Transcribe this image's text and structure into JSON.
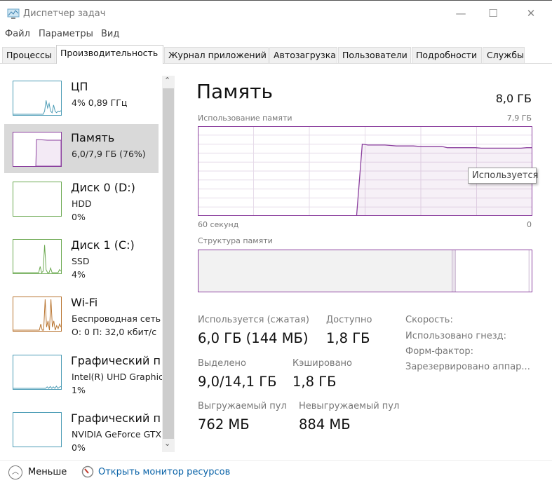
{
  "window": {
    "title": "Диспетчер задач",
    "minimize": "—",
    "maximize": "☐",
    "close": "✕"
  },
  "menu": [
    "Файл",
    "Параметры",
    "Вид"
  ],
  "tabs": [
    "Процессы",
    "Производительность",
    "Журнал приложений",
    "Автозагрузка",
    "Пользователи",
    "Подробности",
    "Службы"
  ],
  "sidebar": [
    {
      "title": "ЦП",
      "sub1": "4% 0,89 ГГц",
      "sub2": "",
      "color": "#4a9bb5"
    },
    {
      "title": "Память",
      "sub1": "6,0/7,9 ГБ (76%)",
      "sub2": "",
      "color": "#8b3f9e"
    },
    {
      "title": "Диск 0 (D:)",
      "sub1": "HDD",
      "sub2": "0%",
      "color": "#6aa84f"
    },
    {
      "title": "Диск 1 (C:)",
      "sub1": "SSD",
      "sub2": "4%",
      "color": "#6aa84f"
    },
    {
      "title": "Wi-Fi",
      "sub1": "Беспроводная сеть",
      "sub2": "О: 0 П: 32,0 кбит/с",
      "color": "#b8732e"
    },
    {
      "title": "Графический п",
      "sub1": "Intel(R) UHD Graphic",
      "sub2": "1%",
      "color": "#4a9bb5"
    },
    {
      "title": "Графический п",
      "sub1": "NVIDIA GeForce GTX",
      "sub2": "0%",
      "color": "#4a9bb5"
    }
  ],
  "main": {
    "title": "Память",
    "total": "8,0 ГБ",
    "usage_label": "Использование памяти",
    "usage_max": "7,9 ГБ",
    "time_left": "60 секунд",
    "time_right": "0",
    "tooltip": "Используется",
    "structure_label": "Структура памяти",
    "usage_series": [
      null,
      null,
      null,
      null,
      null,
      null,
      null,
      null,
      null,
      null,
      null,
      null,
      null,
      null,
      null,
      null,
      null,
      null,
      null,
      null,
      null,
      null,
      null,
      null,
      null,
      null,
      null,
      null,
      0,
      0.8,
      0.79,
      0.79,
      0.79,
      0.79,
      0.785,
      0.78,
      0.78,
      0.78,
      0.78,
      0.775,
      0.775,
      0.775,
      0.775,
      0.775,
      0.76,
      0.76,
      0.76,
      0.76,
      0.76,
      0.76,
      0.755,
      0.755,
      0.755,
      0.755,
      0.755,
      0.755,
      0.755,
      0.755,
      0.76,
      0.76
    ],
    "structure": {
      "in_use": 0.76,
      "modified": 0.01,
      "standby": 0.22,
      "free": 0.01
    },
    "stats": [
      {
        "label": "Используется (сжатая)",
        "value": "6,0 ГБ (144 МБ)"
      },
      {
        "label": "Доступно",
        "value": "1,8 ГБ"
      },
      {
        "label": "Выделено",
        "value": "9,0/14,1 ГБ"
      },
      {
        "label": "Кэшировано",
        "value": "1,8 ГБ"
      },
      {
        "label": "Выгружаемый пул",
        "value": "762 МБ"
      },
      {
        "label": "Невыгружаемый пул",
        "value": "884 МБ"
      }
    ],
    "right_stats": [
      "Скорость:",
      "Использовано гнезд:",
      "Форм-фактор:",
      "Зарезервировано аппар..."
    ]
  },
  "footer": {
    "less": "Меньше",
    "monitor": "Открыть монитор ресурсов"
  }
}
